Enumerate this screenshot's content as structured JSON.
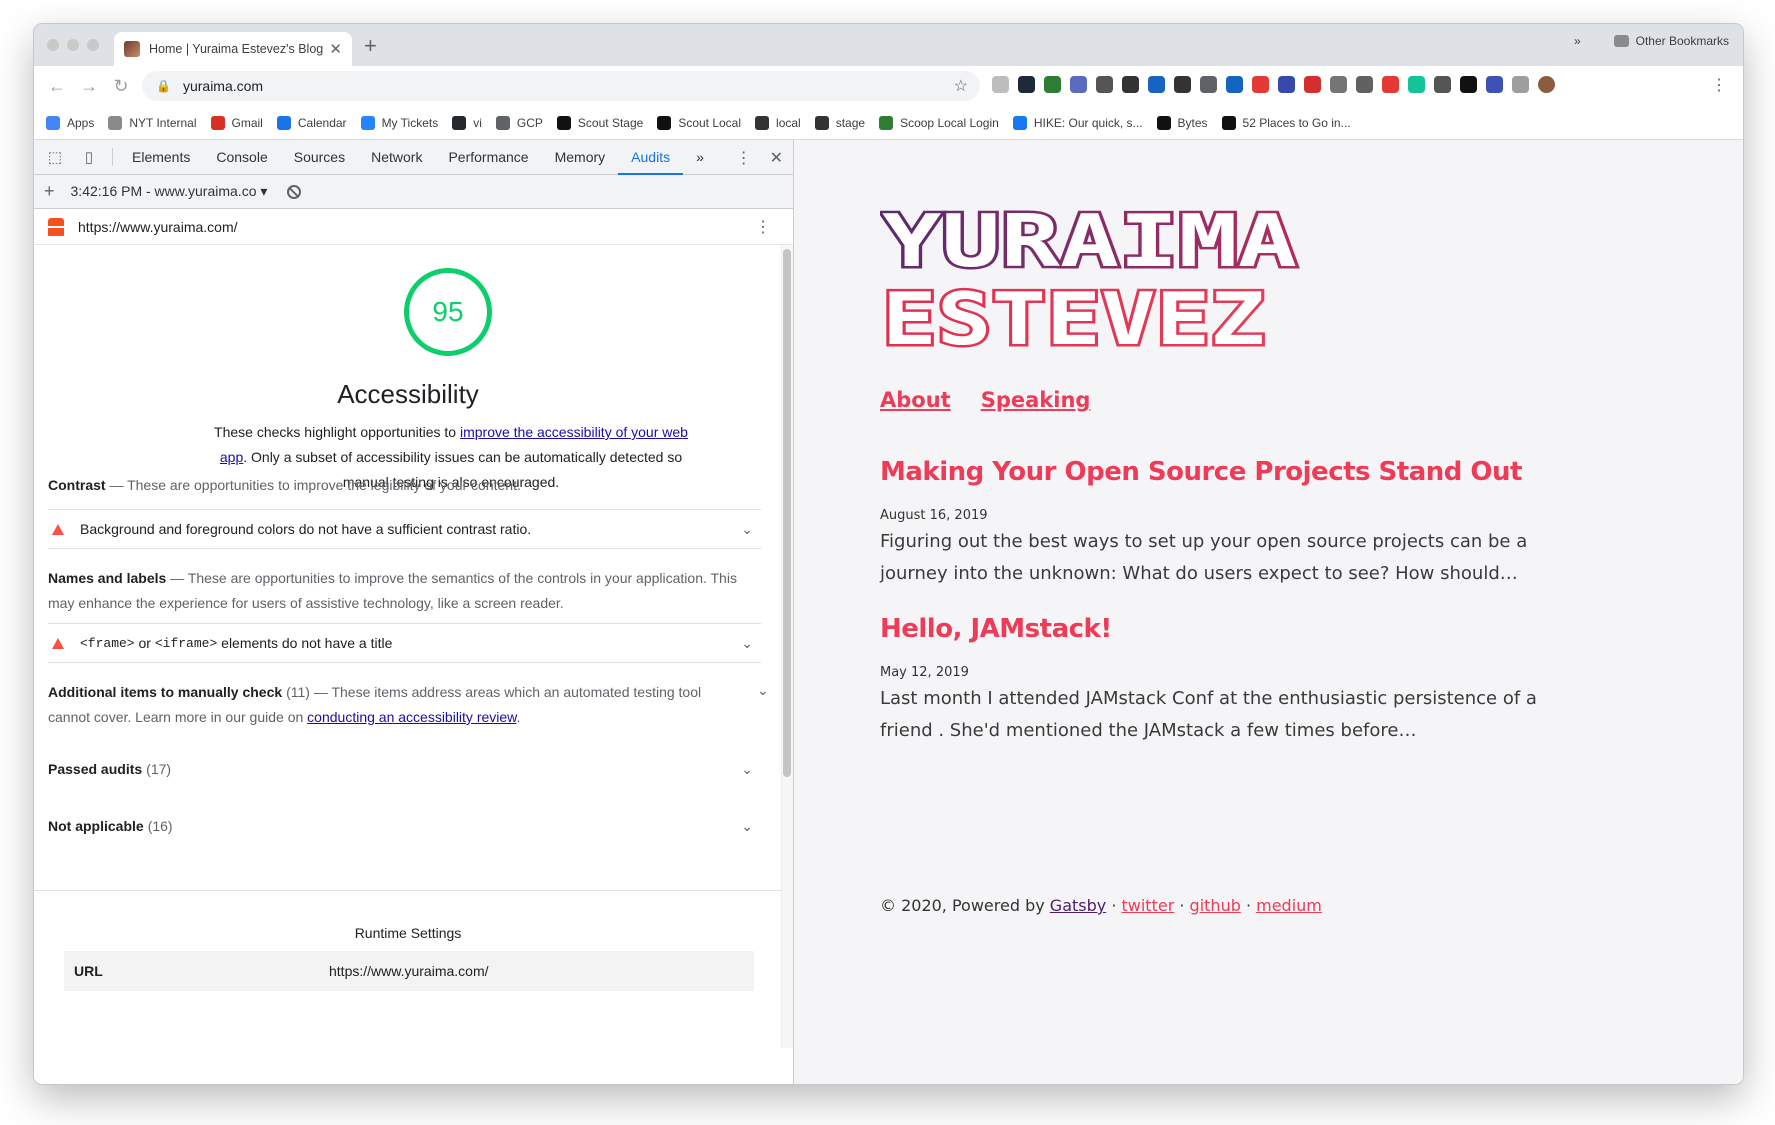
{
  "browser": {
    "tab_title": "Home | Yuraima Estevez's Blog",
    "tab_close": "✕",
    "new_tab": "+",
    "url": "yuraima.com",
    "back": "←",
    "forward": "→",
    "reload": "↻",
    "star": "☆",
    "menu": "⋮",
    "bookmarks": [
      {
        "label": "Apps",
        "color": "#4285f4"
      },
      {
        "label": "NYT Internal",
        "color": "#8a8a8a"
      },
      {
        "label": "Gmail",
        "color": "#d93025"
      },
      {
        "label": "Calendar",
        "color": "#1a73e8"
      },
      {
        "label": "My Tickets",
        "color": "#2684ff"
      },
      {
        "label": "vi",
        "color": "#24292e"
      },
      {
        "label": "GCP",
        "color": "#5f6368"
      },
      {
        "label": "Scout Stage",
        "color": "#111111"
      },
      {
        "label": "Scout Local",
        "color": "#111111"
      },
      {
        "label": "local",
        "color": "#333333"
      },
      {
        "label": "stage",
        "color": "#333333"
      },
      {
        "label": "Scoop Local Login",
        "color": "#2e7d32"
      },
      {
        "label": "HIKE: Our quick, s...",
        "color": "#1877f2"
      },
      {
        "label": "Bytes",
        "color": "#111111"
      },
      {
        "label": "52 Places to Go in...",
        "color": "#111111"
      }
    ],
    "bookmarks_more": "»",
    "other_bookmarks": "Other Bookmarks",
    "extension_colors": [
      "#bdbdbd",
      "#1e2a3a",
      "#2e7d32",
      "#5c6bc0",
      "#555555",
      "#333333",
      "#1565c0",
      "#333333",
      "#5f6368",
      "#1565c0",
      "#e53935",
      "#3949ab",
      "#d32f2f",
      "#757575",
      "#616161",
      "#e53935",
      "#15c39a",
      "#555555",
      "#111111",
      "#3f51b5",
      "#9e9e9e",
      "#8d5b3e"
    ]
  },
  "devtools": {
    "tabs": [
      "Elements",
      "Console",
      "Sources",
      "Network",
      "Performance",
      "Memory",
      "Audits"
    ],
    "active_tab": "Audits",
    "more": "»",
    "kebab": "⋮",
    "close": "✕",
    "inspect_icon": "⬚",
    "device_icon": "▯",
    "plus": "+",
    "report_label": "3:42:16 PM - www.yuraima.co",
    "report_caret": "▾",
    "report_url": "https://www.yuraima.com/",
    "kebab2": "⋮"
  },
  "audit": {
    "score": "95",
    "score_color": "#0cce6b",
    "category": "Accessibility",
    "desc_pre": "These checks highlight opportunities to ",
    "desc_link": "improve the accessibility of your web app",
    "desc_post": ". Only a subset of accessibility issues can be automatically detected so manual testing is also encouraged.",
    "groups": [
      {
        "title": "Contrast",
        "desc": "These are opportunities to improve the legibility of your content.",
        "audits": [
          {
            "title": "Background and foreground colors do not have a sufficient contrast ratio."
          }
        ]
      },
      {
        "title": "Names and labels",
        "desc": "These are opportunities to improve the semantics of the controls in your application. This may enhance the experience for users of assistive technology, like a screen reader.",
        "audits": [
          {
            "code1": "<frame>",
            "or": " or ",
            "code2": "<iframe>",
            "rest": " elements do not have a title"
          }
        ]
      }
    ],
    "manual": {
      "title": "Additional items to manually check",
      "count": "(11)",
      "desc": "These items address areas which an automated testing tool cannot cover. Learn more in our guide on ",
      "link": "conducting an accessibility review",
      "end": "."
    },
    "passed": {
      "title": "Passed audits",
      "count": "(17)"
    },
    "not_applicable": {
      "title": "Not applicable",
      "count": "(16)"
    },
    "separator": "—",
    "chevron": "⌄",
    "runtime_title": "Runtime Settings",
    "runtime_key": "URL",
    "runtime_value": "https://www.yuraima.com/"
  },
  "site": {
    "logo_line1": "YURAIMA",
    "logo_line2": "ESTEVEZ",
    "nav": [
      "About",
      "Speaking"
    ],
    "accent": "#ee3b57",
    "logo_purple": "#6a2a6a",
    "posts": [
      {
        "title": "Making Your Open Source Projects Stand Out",
        "date": "August 16, 2019",
        "excerpt": "Figuring out the best ways to set up your open source projects can be a journey into the unknown: What do users expect to see? How should…"
      },
      {
        "title": "Hello, JAMstack!",
        "date": "May 12, 2019",
        "excerpt": "Last month I attended JAMstack Conf at the enthusiastic persistence of a friend . She'd mentioned the JAMstack a few times before…"
      }
    ],
    "footer": {
      "prefix": "© 2020, Powered by ",
      "gatsby": "Gatsby",
      "sep": " · ",
      "twitter": "twitter",
      "github": "github",
      "medium": "medium"
    }
  }
}
